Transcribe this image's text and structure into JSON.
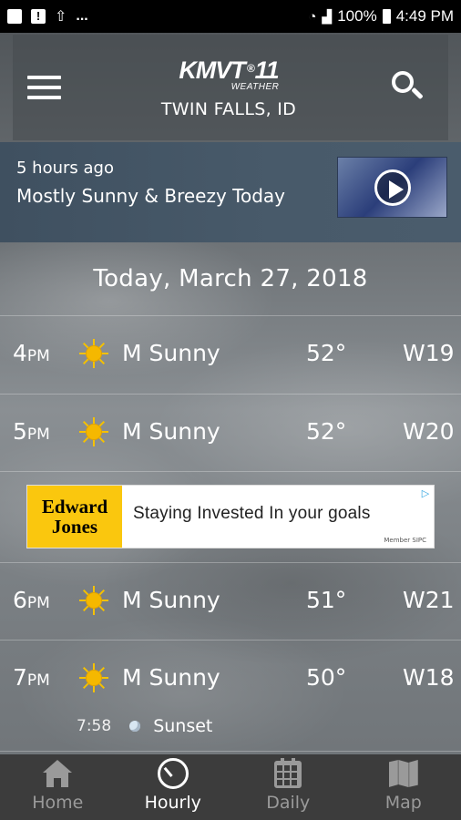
{
  "status_bar": {
    "notification_icons": [
      "image-icon",
      "alert-icon",
      "upload-icon"
    ],
    "more": "...",
    "battery": "100%",
    "time": "4:49 PM"
  },
  "header": {
    "logo": "KMVT",
    "logo_number": "11",
    "logo_sub": "WEATHER",
    "location": "TWIN FALLS, ID"
  },
  "news": {
    "time_ago": "5 hours ago",
    "title": "Mostly Sunny & Breezy Today"
  },
  "forecast": {
    "date": "Today, March 27, 2018",
    "hours": [
      {
        "hour": "4",
        "meridiem": "PM",
        "icon": "sun-icon",
        "condition": "M Sunny",
        "temp": "52°",
        "wind": "W19"
      },
      {
        "hour": "5",
        "meridiem": "PM",
        "icon": "sun-icon",
        "condition": "M Sunny",
        "temp": "52°",
        "wind": "W20"
      },
      {
        "hour": "6",
        "meridiem": "PM",
        "icon": "sun-icon",
        "condition": "M Sunny",
        "temp": "51°",
        "wind": "W21"
      },
      {
        "hour": "7",
        "meridiem": "PM",
        "icon": "sun-icon",
        "condition": "M Sunny",
        "temp": "50°",
        "wind": "W18"
      }
    ],
    "sunset": {
      "time": "7:58",
      "label": "Sunset"
    }
  },
  "ad": {
    "brand_line1": "Edward",
    "brand_line2": "Jones",
    "headline": "Staying Invested In your goals",
    "disclaimer": "Member SIPC",
    "brand_color": "#fac70e"
  },
  "tabs": [
    {
      "label": "Home",
      "icon": "home-icon",
      "active": false
    },
    {
      "label": "Hourly",
      "icon": "clock-icon",
      "active": true
    },
    {
      "label": "Daily",
      "icon": "calendar-icon",
      "active": false
    },
    {
      "label": "Map",
      "icon": "map-icon",
      "active": false
    }
  ]
}
